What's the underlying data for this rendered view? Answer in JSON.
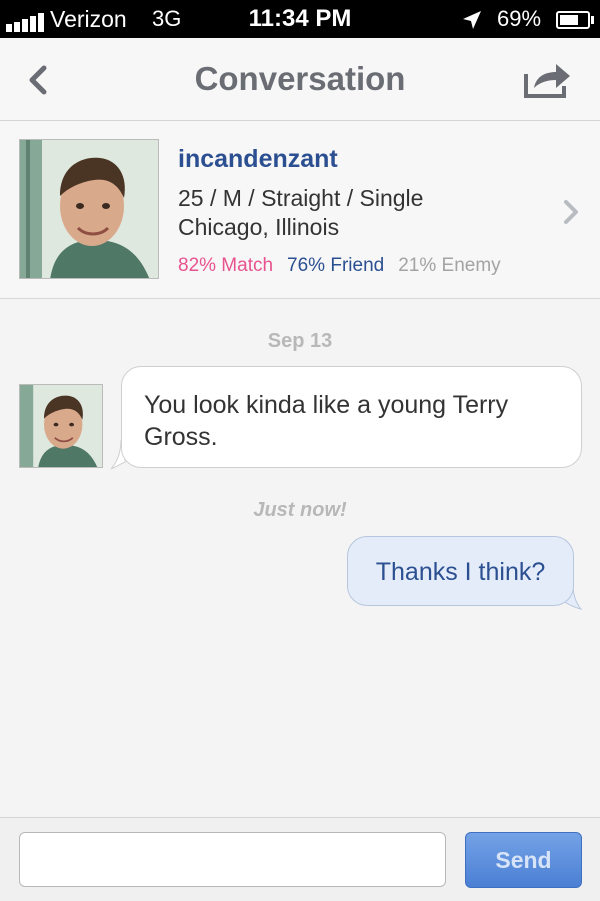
{
  "status_bar": {
    "carrier": "Verizon",
    "network": "3G",
    "time": "11:34 PM",
    "battery": "69%",
    "icons": [
      "signal-bars-icon",
      "location-arrow-icon",
      "battery-icon"
    ]
  },
  "navbar": {
    "title": "Conversation",
    "back_icon": "chevron-left-icon",
    "share_icon": "share-arrow-icon"
  },
  "profile": {
    "username": "incandenzant",
    "details_line1": "25 / M / Straight / Single",
    "details_line2": "Chicago, Illinois",
    "match": "82% Match",
    "friend": "76% Friend",
    "enemy": "21% Enemy",
    "accent_match": "#e8538f",
    "accent_friend": "#2b4f91"
  },
  "messages": {
    "date": "Sep 13",
    "incoming_text": "You look kinda like a young Terry Gross.",
    "time": "Just now!",
    "outgoing_text": "Thanks I think?"
  },
  "composer": {
    "input_value": "",
    "input_placeholder": "",
    "send_label": "Send"
  }
}
